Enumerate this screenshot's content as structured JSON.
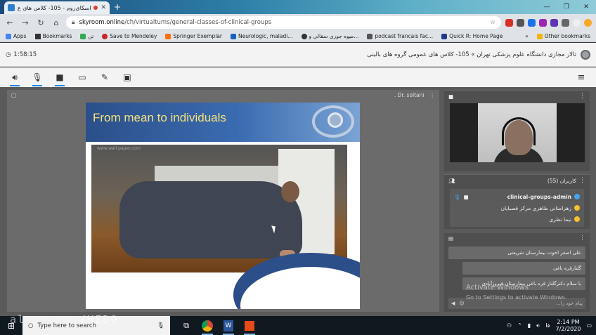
{
  "browser": {
    "tab_title": "اسکای‌روم - 105- کلاس های ع...",
    "url_host": "skyroom.online",
    "url_path": "/ch/virtualtums/general-classes-of-clinical-groups",
    "bookmarks": [
      {
        "label": "Apps"
      },
      {
        "label": "Bookmarks"
      },
      {
        "label": "تن"
      },
      {
        "label": "Save to Mendeley"
      },
      {
        "label": "Springer Exemplar"
      },
      {
        "label": "Neurologic, maladi..."
      },
      {
        "label": "میوه جوری سقالی و..."
      },
      {
        "label": "podcast francais fac..."
      },
      {
        "label": "Quick R: Home Page"
      }
    ],
    "more": "»",
    "other_bookmarks": "Other bookmarks"
  },
  "room": {
    "elapsed": "1:58:15",
    "title": "تالار مجازی دانشگاه علوم پزشکی تهران » 105- کلاس های عمومی گروه های بالینی"
  },
  "stage": {
    "presenter": ". Dr. soltani",
    "slide_title": "From mean to individuals",
    "photo_caption": "www.wall-paper.com"
  },
  "users_panel": {
    "title": "کاربران (55)",
    "users": [
      {
        "name": "clinical-groups-admin"
      },
      {
        "name": "زهرامنانی طاهری مرکز قصبایان"
      },
      {
        "name": "نیما نظری"
      }
    ]
  },
  "chat_panel": {
    "messages": [
      {
        "text": "علی اصغر اخوت بیمارستان شریعتی"
      },
      {
        "text": "گلنارقره باغی"
      },
      {
        "text": "با سلام دکترگلنار قره باغی بیمارستان فیروزآبادی"
      }
    ],
    "placeholder": "پیام خود را...",
    "watermark_1": "Activate Windows",
    "watermark_2": "Go to Settings to activate Windows."
  },
  "taskbar": {
    "search_placeholder": "Type here to search",
    "time": "2:14 PM",
    "date": "7/2/2020",
    "lang": "فا",
    "overlay_logo": "al··· ·· /HEDO"
  }
}
